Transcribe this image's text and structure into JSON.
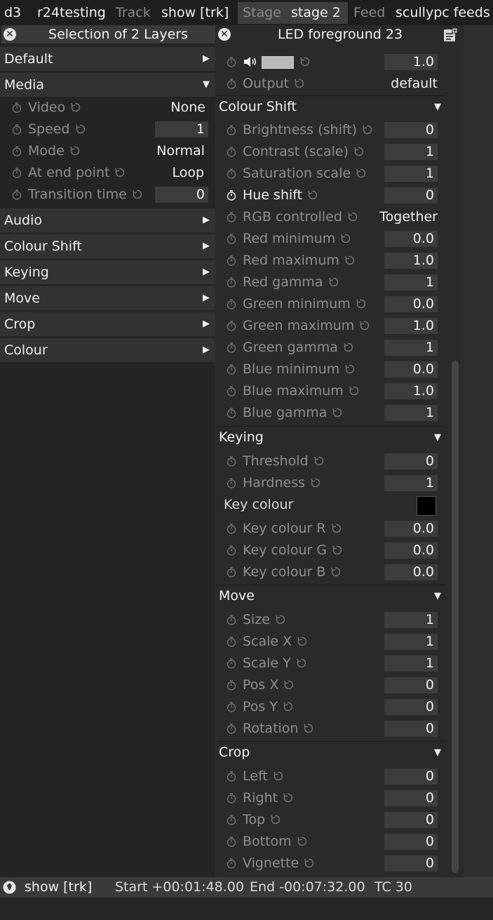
{
  "topbar": {
    "app": "d3",
    "project": "r24testing",
    "track_label": "Track",
    "track_value": "show [trk]",
    "stage_label": "Stage",
    "stage_value": "stage 2",
    "feed_label": "Feed",
    "feed_value": "scullypc feeds"
  },
  "left_panel": {
    "title": "Selection of 2 Layers",
    "sections": {
      "default": "Default",
      "media": "Media",
      "audio": "Audio",
      "colour_shift": "Colour Shift",
      "keying": "Keying",
      "move": "Move",
      "crop": "Crop",
      "colour": "Colour"
    },
    "media_props": [
      {
        "label": "Video",
        "value": "None"
      },
      {
        "label": "Speed",
        "value": "1"
      },
      {
        "label": "Mode",
        "value": "Normal"
      },
      {
        "label": "At end point",
        "value": "Loop"
      },
      {
        "label": "Transition time",
        "value": "0"
      }
    ]
  },
  "right_panel": {
    "title": "LED foreground 23",
    "volume_value": "1.0",
    "output_label": "Output",
    "output_value": "default",
    "colour_shift": {
      "title": "Colour Shift",
      "props": [
        {
          "label": "Brightness (shift)",
          "value": "0"
        },
        {
          "label": "Contrast (scale)",
          "value": "1"
        },
        {
          "label": "Saturation scale",
          "value": "1"
        },
        {
          "label": "Hue shift",
          "value": "0"
        },
        {
          "label": "RGB controlled",
          "value": "Together"
        },
        {
          "label": "Red minimum",
          "value": "0.0"
        },
        {
          "label": "Red maximum",
          "value": "1.0"
        },
        {
          "label": "Red gamma",
          "value": "1"
        },
        {
          "label": "Green minimum",
          "value": "0.0"
        },
        {
          "label": "Green maximum",
          "value": "1.0"
        },
        {
          "label": "Green gamma",
          "value": "1"
        },
        {
          "label": "Blue minimum",
          "value": "0.0"
        },
        {
          "label": "Blue maximum",
          "value": "1.0"
        },
        {
          "label": "Blue gamma",
          "value": "1"
        }
      ]
    },
    "keying": {
      "title": "Keying",
      "props": [
        {
          "label": "Threshold",
          "value": "0"
        },
        {
          "label": "Hardness",
          "value": "1"
        }
      ],
      "key_colour_label": "Key colour",
      "key_colour_swatch": "#000000",
      "rgb_props": [
        {
          "label": "Key colour R",
          "value": "0.0"
        },
        {
          "label": "Key colour G",
          "value": "0.0"
        },
        {
          "label": "Key colour B",
          "value": "0.0"
        }
      ]
    },
    "move": {
      "title": "Move",
      "props": [
        {
          "label": "Size",
          "value": "1"
        },
        {
          "label": "Scale X",
          "value": "1"
        },
        {
          "label": "Scale Y",
          "value": "1"
        },
        {
          "label": "Pos X",
          "value": "0"
        },
        {
          "label": "Pos Y",
          "value": "0"
        },
        {
          "label": "Rotation",
          "value": "0"
        }
      ]
    },
    "crop": {
      "title": "Crop",
      "props": [
        {
          "label": "Left",
          "value": "0"
        },
        {
          "label": "Right",
          "value": "0"
        },
        {
          "label": "Top",
          "value": "0"
        },
        {
          "label": "Bottom",
          "value": "0"
        },
        {
          "label": "Vignette",
          "value": "0"
        }
      ]
    }
  },
  "status": {
    "track": "show [trk]",
    "start": "Start +00:01:48.00",
    "end": "End -00:07:32.00",
    "tc": "TC 30"
  },
  "icons": {
    "close": "close-icon",
    "stopwatch": "stopwatch-icon",
    "reset": "reset-icon",
    "speaker": "speaker-icon",
    "notes": "notes-icon",
    "location": "location-pin-icon"
  },
  "colors": {
    "background": "#2b2b2b",
    "field": "#3c3c3c",
    "dim_text": "#8f8f8f",
    "bright_text": "#f0f0f0"
  }
}
